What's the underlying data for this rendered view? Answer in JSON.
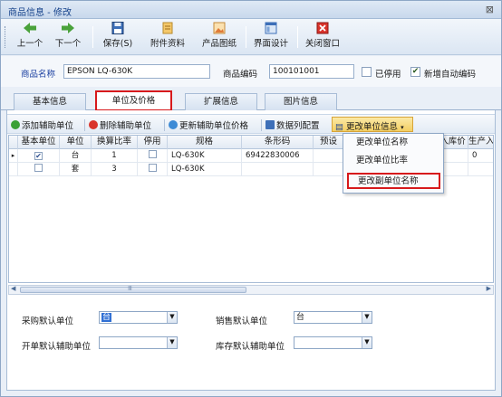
{
  "window": {
    "title": "商品信息 - 修改",
    "close_label": "⊠"
  },
  "toolbar": {
    "buttons": [
      {
        "label": "上一个",
        "icon": "arrow-left-icon"
      },
      {
        "label": "下一个",
        "icon": "arrow-right-icon"
      },
      {
        "label": "保存(S)",
        "icon": "save-icon"
      },
      {
        "label": "附件资料",
        "icon": "attachment-icon"
      },
      {
        "label": "产品图纸",
        "icon": "picture-icon"
      },
      {
        "label": "界面设计",
        "icon": "layout-icon"
      },
      {
        "label": "关闭窗口",
        "icon": "close-window-icon"
      }
    ]
  },
  "info": {
    "name_label": "商品名称",
    "name_value": "EPSON LQ-630K",
    "code_label": "商品编码",
    "code_value": "100101001",
    "disabled_label": "已停用",
    "disabled_checked": false,
    "auto_code_label": "新增自动编码",
    "auto_code_checked": true
  },
  "tabs": [
    {
      "label": "基本信息",
      "active": false
    },
    {
      "label": "单位及价格",
      "active": true
    },
    {
      "label": "扩展信息",
      "active": false
    },
    {
      "label": "图片信息",
      "active": false
    }
  ],
  "subtoolbar": {
    "add": "添加辅助单位",
    "delete": "删除辅助单位",
    "update_price": "更新辅助单位价格",
    "columns": "数据列配置",
    "change_info": "更改单位信息"
  },
  "grid": {
    "headers": [
      "基本单位",
      "单位",
      "换算比率",
      "停用",
      "规格",
      "条形码",
      "预设",
      "入库价",
      "生产入"
    ],
    "rows": [
      {
        "basic": true,
        "unit": "台",
        "ratio": "1",
        "disabled": false,
        "spec": "LQ-630K",
        "barcode": "69422830006",
        "preset": "",
        "instock": "",
        "prod": "0"
      },
      {
        "basic": false,
        "unit": "套",
        "ratio": "3",
        "disabled": false,
        "spec": "LQ-630K",
        "barcode": "",
        "preset": "",
        "instock": "",
        "prod": ""
      }
    ]
  },
  "menu": {
    "items": [
      {
        "label": "更改单位名称",
        "highlighted": false
      },
      {
        "label": "更改单位比率",
        "highlighted": false
      },
      {
        "label": "更改副单位名称",
        "highlighted": true
      }
    ]
  },
  "form": {
    "purchase_label": "采购默认单位",
    "purchase_value": "台",
    "sales_label": "销售默认单位",
    "sales_value": "台",
    "billing_label": "开单默认辅助单位",
    "billing_value": "",
    "stock_label": "库存默认辅助单位",
    "stock_value": ""
  },
  "colors": {
    "accent_red": "#d7191c",
    "label_blue": "#1a3fa0",
    "menu_button": "#f4cf63"
  }
}
